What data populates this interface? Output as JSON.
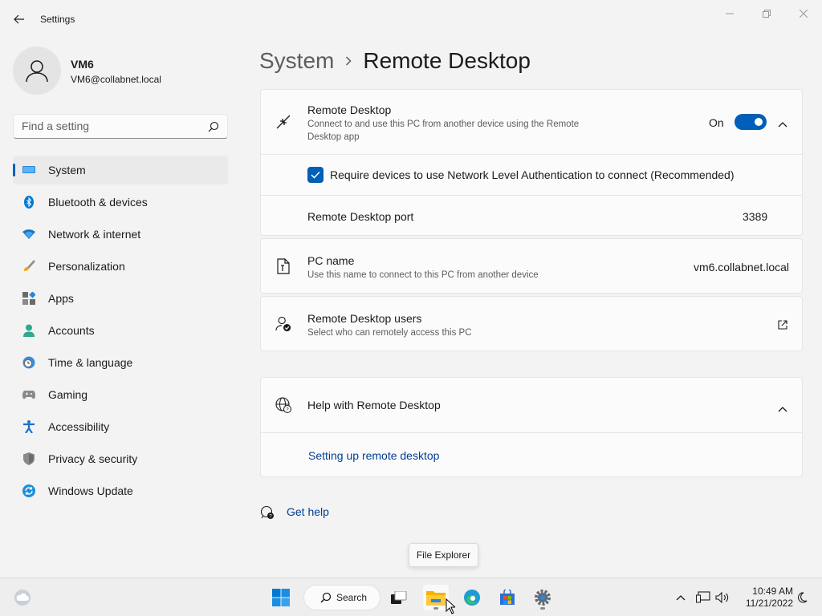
{
  "window": {
    "title": "Settings"
  },
  "profile": {
    "name": "VM6",
    "email": "VM6@collabnet.local"
  },
  "search": {
    "placeholder": "Find a setting"
  },
  "sidebar": {
    "items": [
      {
        "label": "System",
        "icon": "system-icon",
        "active": true
      },
      {
        "label": "Bluetooth & devices",
        "icon": "bluetooth-icon"
      },
      {
        "label": "Network & internet",
        "icon": "wifi-icon"
      },
      {
        "label": "Personalization",
        "icon": "brush-icon"
      },
      {
        "label": "Apps",
        "icon": "apps-icon"
      },
      {
        "label": "Accounts",
        "icon": "person-icon"
      },
      {
        "label": "Time & language",
        "icon": "globe-clock-icon"
      },
      {
        "label": "Gaming",
        "icon": "gamepad-icon"
      },
      {
        "label": "Accessibility",
        "icon": "accessibility-icon"
      },
      {
        "label": "Privacy & security",
        "icon": "shield-icon"
      },
      {
        "label": "Windows Update",
        "icon": "update-icon"
      }
    ]
  },
  "breadcrumb": {
    "parent": "System",
    "current": "Remote Desktop"
  },
  "remote_desktop": {
    "title": "Remote Desktop",
    "description": "Connect to and use this PC from another device using the Remote Desktop app",
    "toggle_label": "On",
    "toggle_on": true,
    "nla_label": "Require devices to use Network Level Authentication to connect (Recommended)",
    "nla_checked": true,
    "port_label": "Remote Desktop port",
    "port_value": "3389"
  },
  "pc_name": {
    "title": "PC name",
    "description": "Use this name to connect to this PC from another device",
    "value": "vm6.collabnet.local"
  },
  "rd_users": {
    "title": "Remote Desktop users",
    "description": "Select who can remotely access this PC"
  },
  "help": {
    "title": "Help with Remote Desktop",
    "link": "Setting up remote desktop"
  },
  "get_help": {
    "label": "Get help"
  },
  "tooltip": {
    "text": "File Explorer"
  },
  "taskbar": {
    "search_label": "Search",
    "time": "10:49 AM",
    "date": "11/21/2022"
  },
  "colors": {
    "accent": "#005fb8",
    "background": "#f3f3f3",
    "card": "#fbfbfb"
  }
}
